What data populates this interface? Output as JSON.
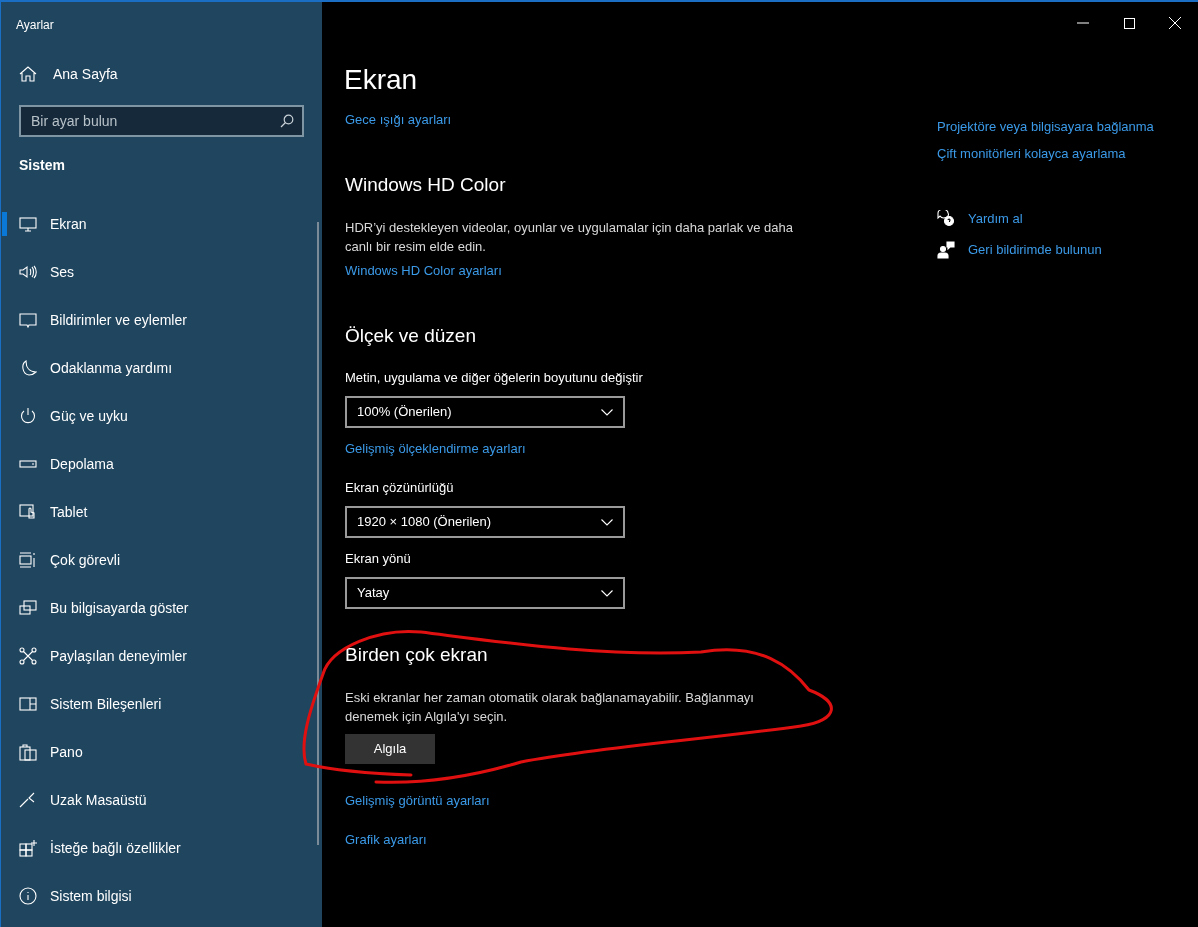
{
  "window": {
    "title": "Ayarlar"
  },
  "sidebar": {
    "home": {
      "label": "Ana Sayfa"
    },
    "search": {
      "placeholder": "Bir ayar bulun"
    },
    "section_title": "Sistem",
    "items": [
      {
        "label": "Ekran",
        "selected": true
      },
      {
        "label": "Ses",
        "selected": false
      },
      {
        "label": "Bildirimler ve eylemler",
        "selected": false
      },
      {
        "label": "Odaklanma yardımı",
        "selected": false
      },
      {
        "label": "Güç ve uyku",
        "selected": false
      },
      {
        "label": "Depolama",
        "selected": false
      },
      {
        "label": "Tablet",
        "selected": false
      },
      {
        "label": "Çok görevli",
        "selected": false
      },
      {
        "label": "Bu bilgisayarda göster",
        "selected": false
      },
      {
        "label": "Paylaşılan deneyimler",
        "selected": false
      },
      {
        "label": "Sistem Bileşenleri",
        "selected": false
      },
      {
        "label": "Pano",
        "selected": false
      },
      {
        "label": "Uzak Masaüstü",
        "selected": false
      },
      {
        "label": "İsteğe bağlı özellikler",
        "selected": false
      },
      {
        "label": "Sistem bilgisi",
        "selected": false
      }
    ]
  },
  "main": {
    "title": "Ekran",
    "blocks": [
      {
        "kind": "link",
        "text": "Gece ışığı ayarları"
      },
      {
        "kind": "heading",
        "text": "Windows HD Color"
      },
      {
        "kind": "paragraph",
        "text": "HDR’yi destekleyen videolar, oyunlar ve uygulamalar için daha parlak ve daha canlı bir resim elde edin."
      },
      {
        "kind": "link",
        "text": "Windows HD Color ayarları"
      },
      {
        "kind": "heading",
        "text": "Ölçek ve düzen"
      },
      {
        "kind": "label",
        "text": "Metin, uygulama ve diğer öğelerin boyutunu değiştir"
      },
      {
        "kind": "dropdown",
        "text": "100% (Önerilen)"
      },
      {
        "kind": "link",
        "text": "Gelişmiş ölçeklendirme ayarları"
      },
      {
        "kind": "label",
        "text": "Ekran çözünürlüğü"
      },
      {
        "kind": "dropdown",
        "text": "1920 × 1080 (Önerilen)"
      },
      {
        "kind": "label",
        "text": "Ekran yönü"
      },
      {
        "kind": "dropdown",
        "text": "Yatay"
      },
      {
        "kind": "heading",
        "text": "Birden çok ekran"
      },
      {
        "kind": "paragraph",
        "text": "Eski ekranlar her zaman otomatik olarak bağlanamayabilir. Bağlanmayı denemek için Algıla'yı seçin."
      },
      {
        "kind": "button",
        "text": "Algıla"
      },
      {
        "kind": "link",
        "text": "Gelişmiş görüntü ayarları"
      },
      {
        "kind": "link",
        "text": "Grafik ayarları"
      }
    ]
  },
  "related_links": [
    "Projektöre veya bilgisayara bağlanma",
    "Çift monitörleri kolayca ayarlama"
  ],
  "help_links": [
    "Yardım al",
    "Geri bildirimde bulunun"
  ]
}
